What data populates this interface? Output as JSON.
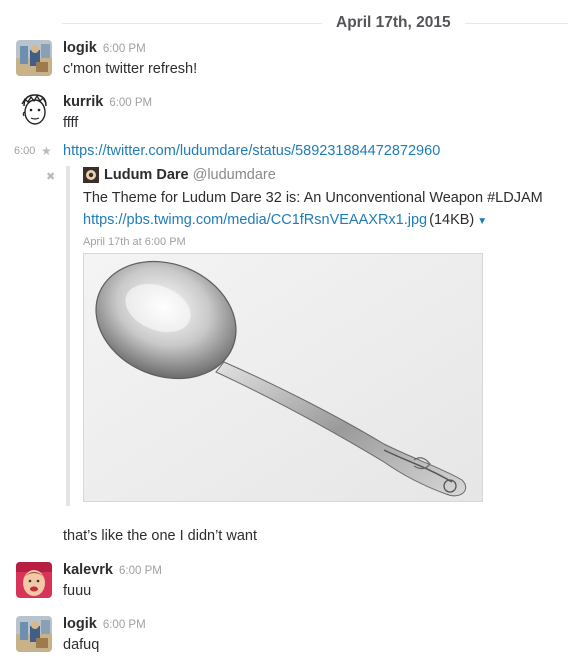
{
  "day_divider": "April 17th, 2015",
  "messages": [
    {
      "sender": "logik",
      "time": "6:00 PM",
      "text": "c'mon twitter refresh!"
    },
    {
      "sender": "kurrik",
      "time": "6:00 PM",
      "text": "ffff"
    },
    {
      "time": "6:00",
      "link": "https://twitter.com/ludumdare/status/589231884472872960"
    },
    {
      "text": "that’s like the one I didn’t want"
    },
    {
      "sender": "kalevrk",
      "time": "6:00 PM",
      "text": "fuuu"
    },
    {
      "sender": "logik",
      "time": "6:00 PM",
      "text": "dafuq"
    }
  ],
  "attachment": {
    "author": "Ludum Dare",
    "handle": "@ludumdare",
    "text": "The Theme for Ludum Dare 32 is: An Unconventional Weapon  #LDJAM",
    "url": "https://pbs.twimg.com/media/CC1fRsnVEAAXRx1.jpg",
    "size": "(14KB)",
    "date": "April 17th at 6:00 PM",
    "image": "spoon-photo"
  },
  "icons": {
    "star": "star-icon",
    "close": "close-icon",
    "caret": "caret-down-icon"
  },
  "colors": {
    "link": "#1f7cb8",
    "divider_text": "#555459",
    "timestamp": "#a0a0a2"
  }
}
